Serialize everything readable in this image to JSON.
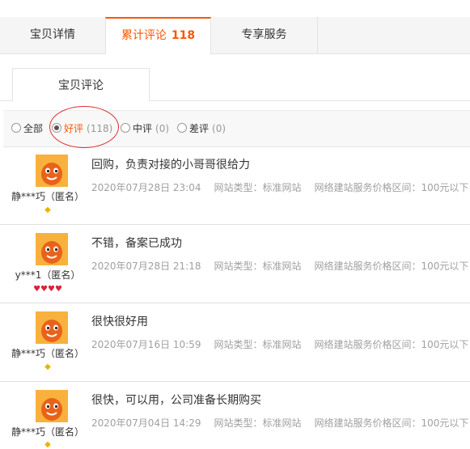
{
  "tabs": [
    {
      "label": "宝贝详情",
      "count": ""
    },
    {
      "label": "累计评论",
      "count": "118"
    },
    {
      "label": "专享服务",
      "count": ""
    }
  ],
  "subtab": {
    "label": "宝贝评论"
  },
  "filters": [
    {
      "label": "全部",
      "count": ""
    },
    {
      "label": "好评",
      "count": "(118)"
    },
    {
      "label": "中评",
      "count": "(0)"
    },
    {
      "label": "差评",
      "count": "(0)"
    }
  ],
  "reviews": [
    {
      "user": "静***巧（匿名）",
      "level_icons": "◆",
      "text": "回购，负责对接的小哥哥很给力",
      "date": "2020年07月28日 23:04",
      "type": "网站类型：标准网站",
      "price": "网络建站服务价格区间：100元以下"
    },
    {
      "user": "y***1（匿名）",
      "level_icons": "♥♥♥♥",
      "text": "不错，备案已成功",
      "date": "2020年07月28日 21:18",
      "type": "网站类型：标准网站",
      "price": "网络建站服务价格区间：100元以下"
    },
    {
      "user": "静***巧（匿名）",
      "level_icons": "◆",
      "text": "很快很好用",
      "date": "2020年07月16日 10:59",
      "type": "网站类型：标准网站",
      "price": "网络建站服务价格区间：100元以下"
    },
    {
      "user": "静***巧（匿名）",
      "level_icons": "◆",
      "text": "很快，可以用，公司准备长期购买",
      "date": "2020年07月04日 14:29",
      "type": "网站类型：标准网站",
      "price": "网络建站服务价格区间：100元以下"
    }
  ],
  "colors": {
    "accent": "#ff5500",
    "highlight_circle": "#e03030"
  }
}
